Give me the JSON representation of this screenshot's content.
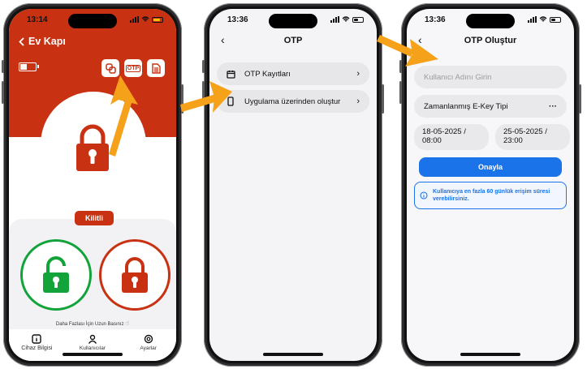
{
  "phone1": {
    "status_time": "13:14",
    "title": "Ev Kapı",
    "top_icon_otp": "OTP",
    "lock_status": "Kilitli",
    "hint": "Daha Fazlası İçin Uzun Basınız",
    "tabs": [
      {
        "label": "Cihaz Bilgisi",
        "icon": "info-icon"
      },
      {
        "label": "Kullanıcılar",
        "icon": "user-icon"
      },
      {
        "label": "Ayarlar",
        "icon": "settings-icon"
      }
    ]
  },
  "phone2": {
    "status_time": "13:36",
    "title": "OTP",
    "items": [
      {
        "label": "OTP Kayıtları",
        "icon": "calendar-icon"
      },
      {
        "label": "Uygulama üzerinden oluştur",
        "icon": "phone-icon"
      }
    ]
  },
  "phone3": {
    "status_time": "13:36",
    "title": "OTP Oluştur",
    "username_placeholder": "Kullanıcı Adını Girin",
    "ekey_type": "Zamanlanmış E-Key Tipi",
    "ekey_dots": "···",
    "start_date": "18-05-2025 /",
    "start_time": "08:00",
    "end_date": "25-05-2025 /",
    "end_time": "23:00",
    "confirm_label": "Onayla",
    "info_text": "Kullanıcıya en fazla 60 günlük erişim süresi verebilirsiniz."
  },
  "colors": {
    "brand_red": "#c83112",
    "unlock_green": "#13a33b",
    "accent_blue": "#1a73e8",
    "arrow_orange": "#f5a11a"
  }
}
